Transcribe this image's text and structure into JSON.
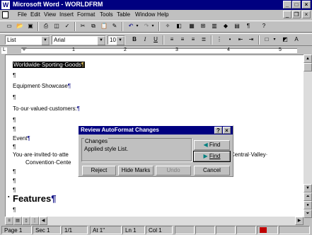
{
  "window": {
    "title": "Microsoft Word - WORLDFRM",
    "app_icon": "W",
    "min": "_",
    "max": "□",
    "close": "×"
  },
  "menu": [
    "File",
    "Edit",
    "View",
    "Insert",
    "Format",
    "Tools",
    "Table",
    "Window",
    "Help"
  ],
  "formatting": {
    "style": "List",
    "font": "Arial",
    "size": "10",
    "bold": "B",
    "italic": "I",
    "underline": "U"
  },
  "ruler": {
    "n1": "1",
    "n2": "2",
    "n3": "3",
    "n4": "4",
    "n5": "5"
  },
  "document": {
    "line_company": "Worldwide·Sporting·Goods",
    "pilcrow": "¶",
    "line_equipment": "Equipment·Showcase",
    "line_salutation": "To·our·valued·customers:",
    "line_event": "Event",
    "line_invite_a": "You·are·invited·to·atte",
    "line_invite_b": "Central·Valley·",
    "line_convention": "Convention·Cente",
    "heading_features": "Features",
    "bullet": "▪"
  },
  "dialog": {
    "title": "Review AutoFormat Changes",
    "help": "?",
    "close": "×",
    "group_label": "Changes",
    "description": "Applied style List.",
    "find_back": "Find",
    "find_forward": "Find",
    "reject": "Reject",
    "hide_marks": "Hide Marks",
    "undo": "Undo",
    "cancel": "Cancel"
  },
  "status": {
    "page": "Page  1",
    "sec": "Sec  1",
    "pos": "1/1",
    "at": "At  1\"",
    "ln": "Ln  1",
    "col": "Col  1"
  }
}
